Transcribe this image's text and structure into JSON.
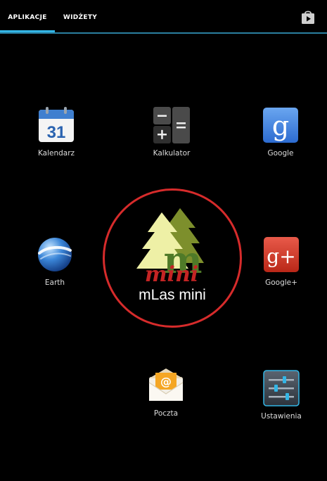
{
  "tabs": [
    {
      "label": "APLIKACJE",
      "selected": true
    },
    {
      "label": "WIDŻETY",
      "selected": false
    }
  ],
  "store_icon": "shopping-bag-icon",
  "apps": {
    "kalendarz": {
      "label": "Kalendarz",
      "icon": "calendar-icon",
      "icon_text": "31"
    },
    "kalkulator": {
      "label": "Kalkulator",
      "icon": "calculator-icon"
    },
    "google": {
      "label": "Google",
      "icon": "google-search-icon",
      "icon_text": "g"
    },
    "earth": {
      "label": "Earth",
      "icon": "earth-globe-icon"
    },
    "googleplus": {
      "label": "Google+",
      "icon": "google-plus-icon",
      "icon_text": "g+"
    },
    "poczta": {
      "label": "Poczta",
      "icon": "email-icon",
      "icon_text": "@"
    },
    "ustawienia": {
      "label": "Ustawienia",
      "icon": "settings-sliders-icon"
    }
  },
  "featured_app": {
    "label": "mLas mini",
    "logo_text": "mini",
    "logo_letter": "m",
    "icon": "mlas-mini-tree-logo-icon"
  },
  "colors": {
    "accent": "#33b5e5",
    "highlight_ring": "#d62b2b",
    "background": "#000000"
  }
}
